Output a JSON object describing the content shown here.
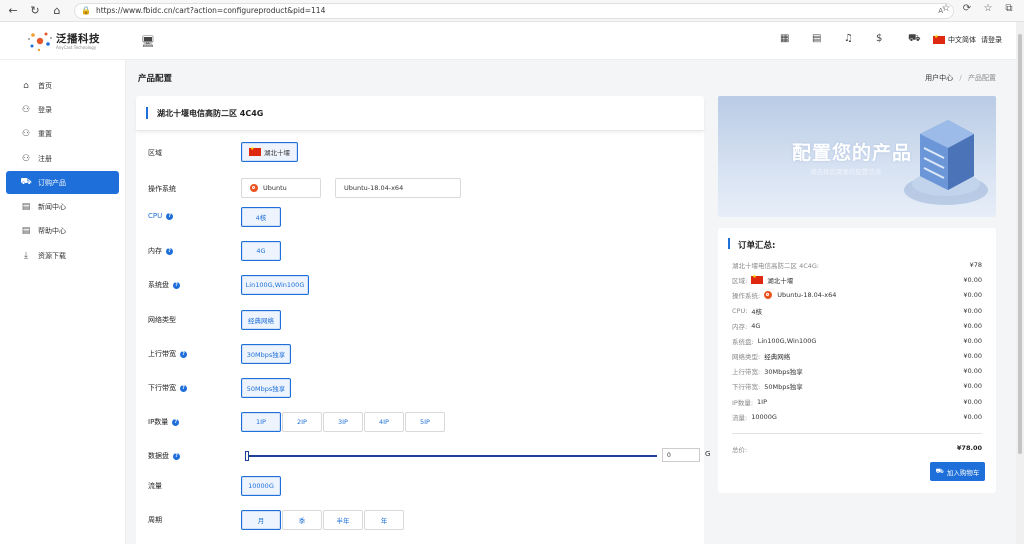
{
  "browser": {
    "url": "https://www.fbidc.cn/cart?action=configureproduct&pid=114",
    "reader_label": "Aʹ"
  },
  "header": {
    "brand": "泛播科技",
    "brand_sub": "AnyCast Technology",
    "language": "中文简体",
    "login": "请登录"
  },
  "sidebar": {
    "items": [
      {
        "label": "首页",
        "icon": "home-icon"
      },
      {
        "label": "登录",
        "icon": "user-icon"
      },
      {
        "label": "重置",
        "icon": "user-icon"
      },
      {
        "label": "注册",
        "icon": "user-icon"
      },
      {
        "label": "订购产品",
        "icon": "cart-icon",
        "active": true
      },
      {
        "label": "新闻中心",
        "icon": "news-icon"
      },
      {
        "label": "帮助中心",
        "icon": "help-icon"
      },
      {
        "label": "资源下载",
        "icon": "download-icon"
      }
    ]
  },
  "page": {
    "title": "产品配置",
    "breadcrumb_home": "用户中心",
    "breadcrumb_sep": "/",
    "breadcrumb_current": "产品配置"
  },
  "config": {
    "product_title": "湖北十堰电信高防二区 4C4G",
    "region_label": "区域",
    "region_value": "湖北十堰",
    "os_label": "操作系统",
    "os_name": "Ubuntu",
    "os_version": "Ubuntu-18.04-x64",
    "cpu_label": "CPU",
    "cpu_value": "4核",
    "memory_label": "内存",
    "memory_value": "4G",
    "disk_label": "系统盘",
    "disk_value": "Lin100G,Win100G",
    "network_label": "网络类型",
    "network_value": "经典网络",
    "upload_label": "上行带宽",
    "upload_value": "30Mbps独享",
    "download_label": "下行带宽",
    "download_value": "50Mbps独享",
    "ip_label": "IP数量",
    "ip_options": [
      "1IP",
      "2IP",
      "3IP",
      "4IP",
      "5IP"
    ],
    "data_disk_label": "数据盘",
    "data_disk_value": "0",
    "data_disk_unit": "G",
    "traffic_label": "流量",
    "traffic_value": "10000G",
    "cycle_label": "周期",
    "cycle_options": [
      "月",
      "季",
      "半年",
      "年"
    ]
  },
  "banner": {
    "title": "配置您的产品",
    "subtitle": "请选择您需要的配置信息"
  },
  "summary": {
    "title": "订单汇总:",
    "rows": [
      {
        "label": "湖北十堰电信高防二区 4C4G:",
        "value": "",
        "price": "¥78"
      },
      {
        "label": "区域:",
        "value": "湖北十堰",
        "price": "¥0.00"
      },
      {
        "label": "操作系统:",
        "value": "Ubuntu-18.04-x64",
        "price": "¥0.00"
      },
      {
        "label": "CPU:",
        "value": "4核",
        "price": "¥0.00"
      },
      {
        "label": "内存:",
        "value": "4G",
        "price": "¥0.00"
      },
      {
        "label": "系统盘:",
        "value": "Lin100G,Win100G",
        "price": "¥0.00"
      },
      {
        "label": "网络类型:",
        "value": "经典网络",
        "price": "¥0.00"
      },
      {
        "label": "上行带宽:",
        "value": "30Mbps独享",
        "price": "¥0.00"
      },
      {
        "label": "下行带宽:",
        "value": "50Mbps独享",
        "price": "¥0.00"
      },
      {
        "label": "IP数量:",
        "value": "1IP",
        "price": "¥0.00"
      },
      {
        "label": "流量:",
        "value": "10000G",
        "price": "¥0.00"
      }
    ],
    "total_label": "总价:",
    "total_price": "¥78.00",
    "cart_button": "加入购物车"
  },
  "colors": {
    "accent": "#1e6fd9",
    "flag_red": "#de2910",
    "ubuntu_orange": "#e95420"
  }
}
